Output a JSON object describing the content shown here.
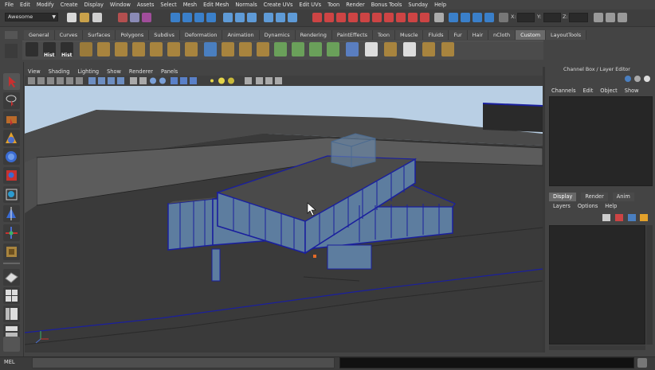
{
  "menu": [
    "File",
    "Edit",
    "Modify",
    "Create",
    "Display",
    "Window",
    "Assets",
    "Select",
    "Mesh",
    "Edit Mesh",
    "Normals",
    "Create UVs",
    "Edit UVs",
    "Toon",
    "Render",
    "Bonus Tools",
    "Sunday",
    "Help"
  ],
  "status": {
    "mode": "Awesome",
    "x_label": "X:",
    "y_label": "Y:",
    "z_label": "Z:"
  },
  "shelf_tabs": [
    "General",
    "Curves",
    "Surfaces",
    "Polygons",
    "Subdivs",
    "Deformation",
    "Animation",
    "Dynamics",
    "Rendering",
    "PaintEffects",
    "Toon",
    "Muscle",
    "Fluids",
    "Fur",
    "Hair",
    "nCloth",
    "Custom",
    "LayoutTools"
  ],
  "active_shelf_tab": "Custom",
  "shelf": {
    "hist1": "Hist",
    "hist2": "Hist"
  },
  "viewport_menu": [
    "View",
    "Shading",
    "Lighting",
    "Show",
    "Renderer",
    "Panels"
  ],
  "right_panel": {
    "title": "Channel Box / Layer Editor",
    "menu": [
      "Channels",
      "Edit",
      "Object",
      "Show"
    ],
    "layer_tabs": [
      "Display",
      "Render",
      "Anim"
    ],
    "active_layer_tab": "Display",
    "layer_menu": [
      "Layers",
      "Options",
      "Help"
    ]
  },
  "command": {
    "label": "MEL"
  },
  "colors": {
    "sky": "#b9cfe4",
    "ground": "#3a3a3a",
    "wire": "#1a1f9e",
    "glass": "#5d7d9f",
    "accent": "#e36a27"
  },
  "icons": [
    "select-arrow-icon",
    "lasso-icon",
    "paint-icon",
    "move-icon",
    "rotate-icon",
    "scale-icon",
    "manip-icon",
    "soft-mod-icon",
    "show-manip-icon",
    "last-tool-icon",
    "layout-single-icon",
    "layout-four-icon",
    "layout-outliner-icon",
    "layout-graph-icon",
    "script-icon"
  ]
}
